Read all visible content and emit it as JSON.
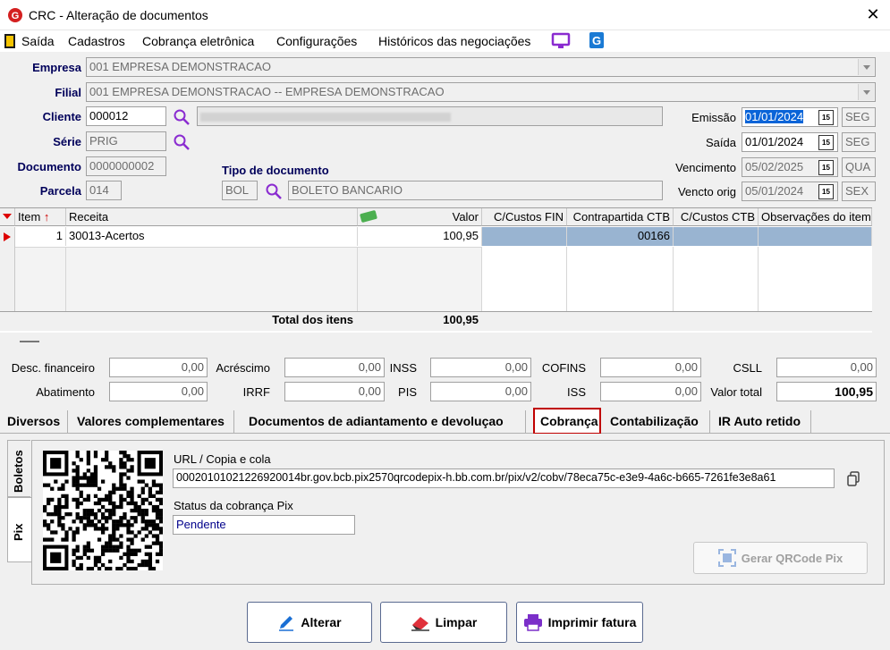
{
  "window": {
    "title": "CRC - Alteração de documentos",
    "close": "✕"
  },
  "menu": {
    "items": [
      "Saída",
      "Cadastros",
      "Cobrança eletrônica",
      "Configurações",
      "Históricos das negociações"
    ]
  },
  "form": {
    "empresa_label": "Empresa",
    "empresa_value": "001 EMPRESA DEMONSTRACAO",
    "filial_label": "Filial",
    "filial_value": "001 EMPRESA DEMONSTRACAO -- EMPRESA DEMONSTRACAO",
    "cliente_label": "Cliente",
    "cliente_value": "000012",
    "serie_label": "Série",
    "serie_value": "PRIG",
    "documento_label": "Documento",
    "documento_value": "0000000002",
    "parcela_label": "Parcela",
    "parcela_value": "014",
    "tipo_label": "Tipo de documento",
    "tipo_code": "BOL",
    "tipo_desc": "BOLETO BANCARIO",
    "emissao_label": "Emissão",
    "emissao_value": "01/01/2024",
    "emissao_day": "SEG",
    "saida_label": "Saída",
    "saida_value": "01/01/2024",
    "saida_day": "SEG",
    "vencimento_label": "Vencimento",
    "vencimento_value": "05/02/2025",
    "vencimento_day": "QUA",
    "vencto_orig_label": "Vencto orig",
    "vencto_orig_value": "05/01/2024",
    "vencto_orig_day": "SEX",
    "date_icon": "15"
  },
  "grid": {
    "headers": [
      "Item",
      "Receita",
      "Valor",
      "C/Custos FIN",
      "Contrapartida CTB",
      "C/Custos CTB",
      "Observações do item"
    ],
    "row": {
      "item": "1",
      "receita": "30013-Acertos",
      "valor": "100,95",
      "contrapartida": "00166"
    },
    "total_label": "Total dos itens",
    "total_value": "100,95"
  },
  "totals": {
    "desc_fin_label": "Desc. financeiro",
    "desc_fin": "0,00",
    "acrescimo_label": "Acréscimo",
    "acrescimo": "0,00",
    "inss_label": "INSS",
    "inss": "0,00",
    "cofins_label": "COFINS",
    "cofins": "0,00",
    "csll_label": "CSLL",
    "csll": "0,00",
    "abatimento_label": "Abatimento",
    "abatimento": "0,00",
    "irrf_label": "IRRF",
    "irrf": "0,00",
    "pis_label": "PIS",
    "pis": "0,00",
    "iss_label": "ISS",
    "iss": "0,00",
    "valor_total_label": "Valor total",
    "valor_total": "100,95"
  },
  "tabs": [
    "Diversos",
    "Valores complementares",
    "Documentos de adiantamento e devoluçao",
    "Cobrança",
    "Contabilização",
    "IR Auto retido"
  ],
  "side_tabs": [
    "Boletos",
    "Pix"
  ],
  "pix": {
    "url_label": "URL / Copia e cola",
    "url_value": "0002010102122692001​4br.gov.bcb.pix2570qrcodepix-h.bb.com.br/pix/v2/cobv/78eca75c-e3e9-4a6c-b665-7261fe3e8a61",
    "status_label": "Status da cobrança Pix",
    "status_value": "Pendente",
    "generate_button": "Gerar QRCode Pix"
  },
  "buttons": {
    "alterar": "Alterar",
    "limpar": "Limpar",
    "imprimir": "Imprimir fatura"
  },
  "colors": {
    "accent": "#00005a",
    "selected_row": "#99b4d1",
    "tab_highlight": "#c00000"
  }
}
